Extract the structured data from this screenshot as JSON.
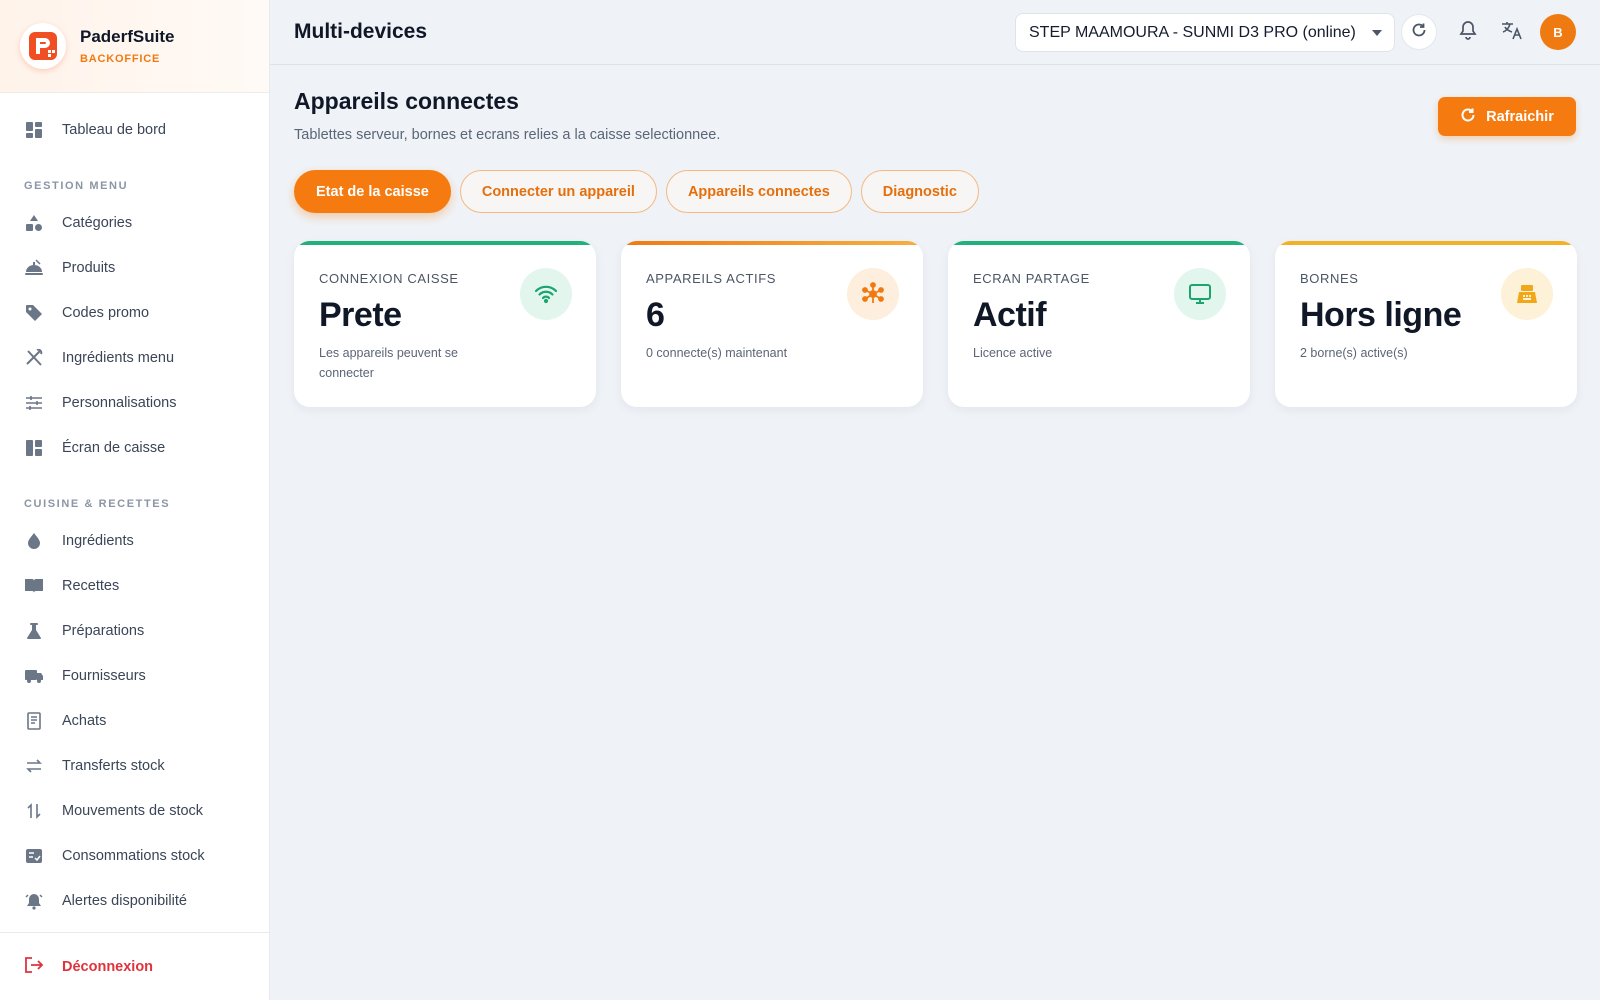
{
  "brand": {
    "name": "PaderfSuite",
    "subtitle": "BACKOFFICE"
  },
  "sidebar": {
    "dashboard": {
      "label": "Tableau de bord",
      "icon": "dashboard-icon"
    },
    "sections": [
      {
        "title": "GESTION MENU",
        "items": [
          {
            "label": "Catégories",
            "icon": "shapes-icon"
          },
          {
            "label": "Produits",
            "icon": "food-tray-icon"
          },
          {
            "label": "Codes promo",
            "icon": "tag-icon"
          },
          {
            "label": "Ingrédients menu",
            "icon": "utensils-icon"
          },
          {
            "label": "Personnalisations",
            "icon": "sliders-icon"
          },
          {
            "label": "Écran de caisse",
            "icon": "layout-icon"
          }
        ]
      },
      {
        "title": "CUISINE & RECETTES",
        "items": [
          {
            "label": "Ingrédients",
            "icon": "drop-icon"
          },
          {
            "label": "Recettes",
            "icon": "book-icon"
          },
          {
            "label": "Préparations",
            "icon": "flask-icon"
          },
          {
            "label": "Fournisseurs",
            "icon": "truck-icon"
          },
          {
            "label": "Achats",
            "icon": "receipt-icon"
          },
          {
            "label": "Transferts stock",
            "icon": "swap-icon"
          },
          {
            "label": "Mouvements de stock",
            "icon": "up-down-icon"
          },
          {
            "label": "Consommations stock",
            "icon": "checklist-icon"
          },
          {
            "label": "Alertes disponibilité",
            "icon": "bell-alert-icon"
          }
        ]
      }
    ],
    "logout": {
      "label": "Déconnexion",
      "icon": "logout-icon"
    }
  },
  "header": {
    "title": "Multi-devices",
    "device_select": "STEP MAAMOURA - SUNMI D3 PRO (online)",
    "avatar_initial": "B"
  },
  "main": {
    "title": "Appareils connectes",
    "description": "Tablettes serveur, bornes et ecrans relies a la caisse selectionnee.",
    "refresh_label": "Rafraichir",
    "tabs": [
      {
        "label": "Etat de la caisse",
        "active": true
      },
      {
        "label": "Connecter un appareil",
        "active": false
      },
      {
        "label": "Appareils connectes",
        "active": false
      },
      {
        "label": "Diagnostic",
        "active": false
      }
    ],
    "cards": [
      {
        "label": "CONNEXION CAISSE",
        "value": "Prete",
        "sub": "Les appareils peuvent se connecter",
        "icon": "wifi-icon",
        "accent": "#22b07d",
        "icon_bg": "#e3f6ee",
        "icon_color": "#1aa56f"
      },
      {
        "label": "APPAREILS ACTIFS",
        "value": "6",
        "sub": "0 connecte(s) maintenant",
        "icon": "network-hub-icon",
        "accent": "#f07a12",
        "icon_bg": "#fdeedd",
        "icon_color": "#f07a12"
      },
      {
        "label": "ECRAN PARTAGE",
        "value": "Actif",
        "sub": "Licence active",
        "icon": "monitor-icon",
        "accent": "#22b07d",
        "icon_bg": "#e3f6ee",
        "icon_color": "#1aa56f"
      },
      {
        "label": "BORNES",
        "value": "Hors ligne",
        "sub": "2 borne(s) active(s)",
        "icon": "kiosk-icon",
        "accent": "#f2b225",
        "icon_bg": "#fdf1d8",
        "icon_color": "#f0a81a"
      }
    ]
  },
  "colors": {
    "accent": "#f57b10",
    "danger": "#e0323c",
    "background": "#eff3f8"
  }
}
